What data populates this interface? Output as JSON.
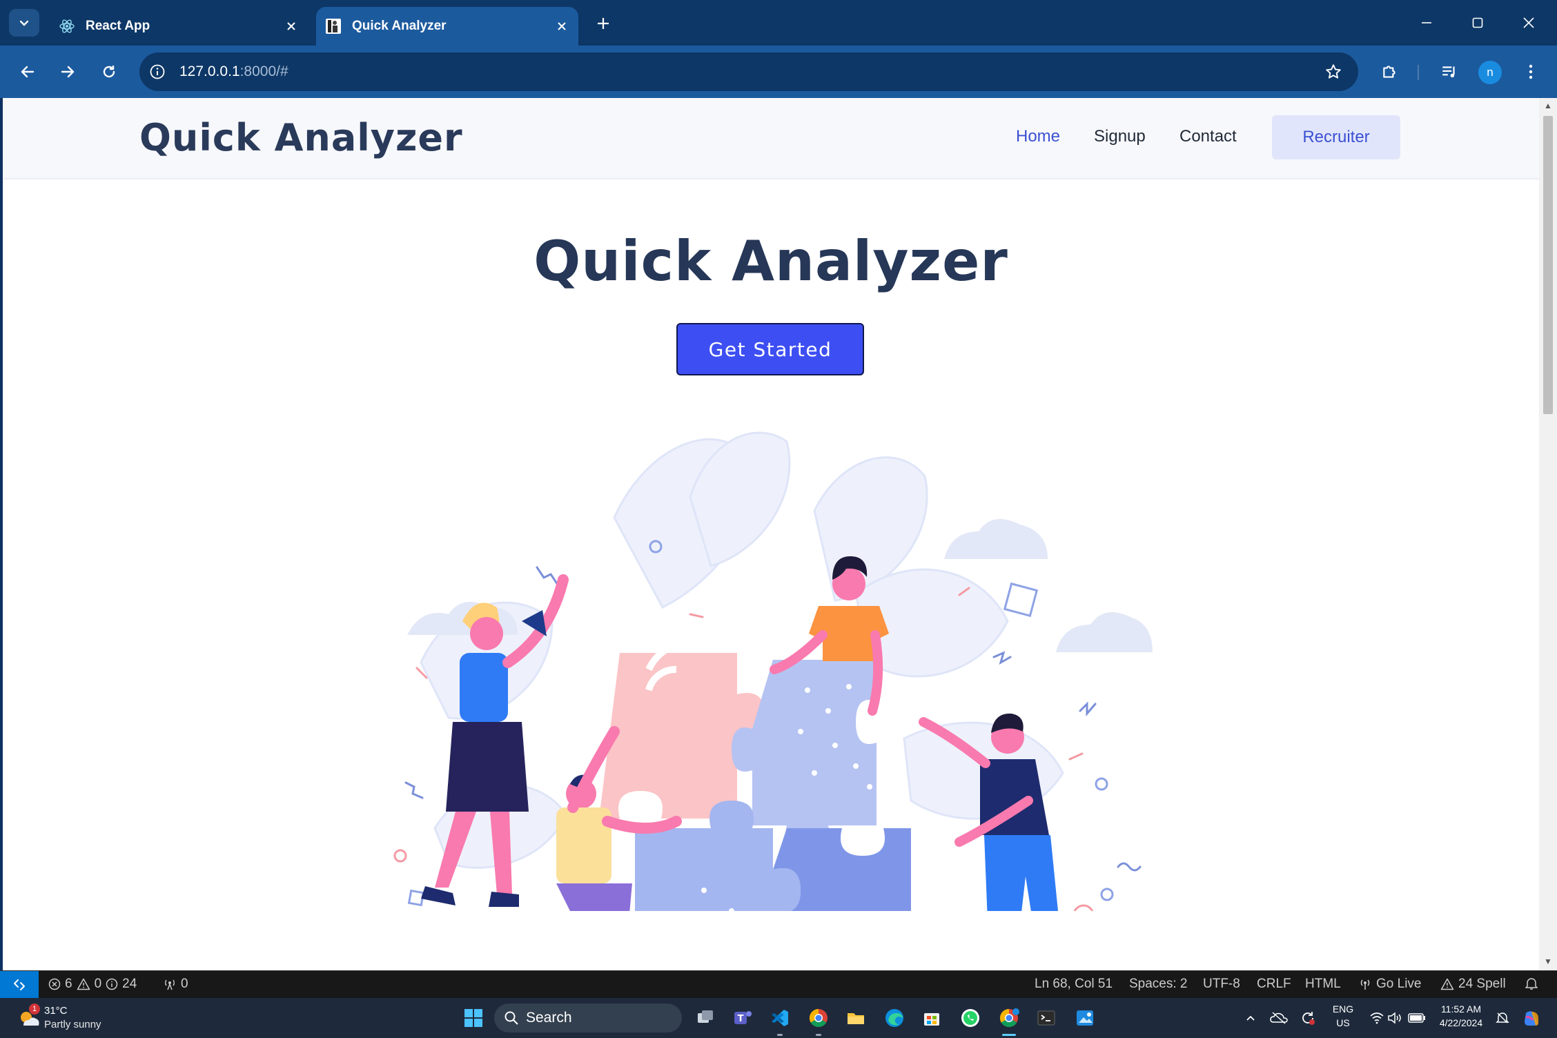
{
  "browser": {
    "tabs": [
      {
        "title": "React App",
        "active": false,
        "favicon": "react-icon"
      },
      {
        "title": "Quick Analyzer",
        "active": true,
        "favicon": "person-icon"
      }
    ],
    "url_host": "127.0.0.1",
    "url_rest": ":8000/#",
    "profile_initial": "n"
  },
  "site": {
    "logo": "Quick Analyzer",
    "nav": {
      "home": "Home",
      "signup": "Signup",
      "contact": "Contact",
      "recruiter": "Recruiter"
    },
    "hero_title": "Quick Analyzer",
    "cta_label": "Get Started",
    "illustration": "team-puzzle-illustration"
  },
  "statusbar": {
    "errors": "6",
    "warnings": "0",
    "infos": "24",
    "ports": "0",
    "position": "Ln 68, Col 51",
    "spaces": "Spaces: 2",
    "encoding": "UTF-8",
    "eol": "CRLF",
    "language": "HTML",
    "golive": "Go Live",
    "spell": "24 Spell"
  },
  "taskbar": {
    "weather_temp": "31°C",
    "weather_cond": "Partly sunny",
    "weather_badge": "1",
    "search_label": "Search",
    "lang_top": "ENG",
    "lang_bottom": "US",
    "time": "11:52 AM",
    "date": "4/22/2024"
  },
  "colors": {
    "accent": "#3d4ff2",
    "chrome_dark": "#0d3766",
    "chrome_light": "#1c5a9e",
    "heading": "#263757"
  }
}
